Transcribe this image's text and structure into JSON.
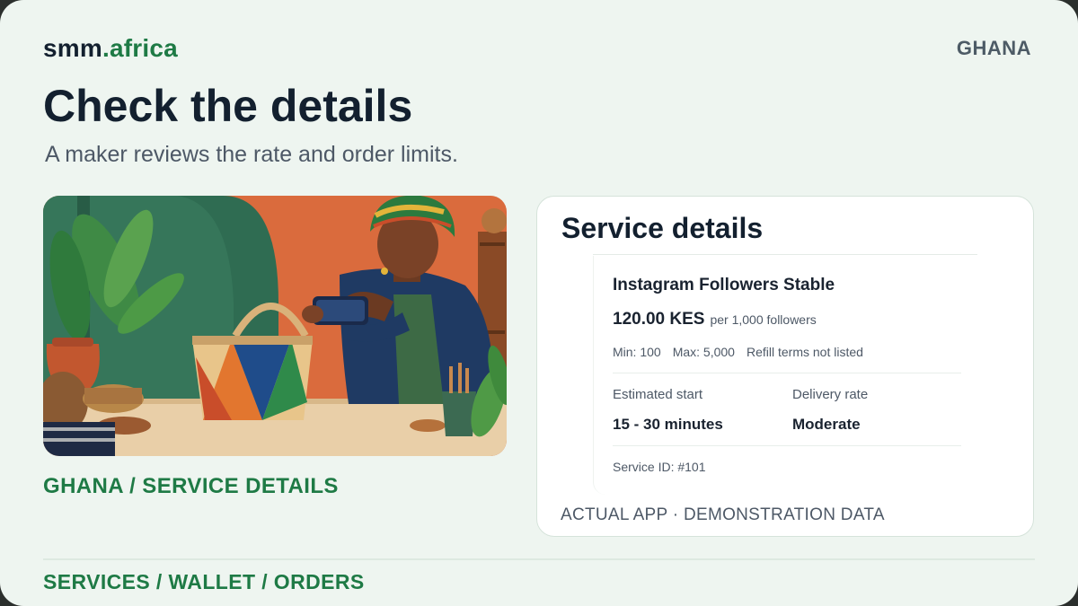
{
  "brand": {
    "name": "smm",
    "accent": ".africa"
  },
  "country": "GHANA",
  "headline": "Check the details",
  "subtitle": "A maker reviews the rate and order limits.",
  "photo_caption": "GHANA / SERVICE DETAILS",
  "card": {
    "title": "Service details",
    "service_name": "Instagram Followers Stable",
    "price": "120.00 KES",
    "price_unit": "per 1,000 followers",
    "min": "Min: 100",
    "max": "Max: 5,000",
    "refill": "Refill terms not listed",
    "estimated_start_label": "Estimated start",
    "estimated_start_value": "15 - 30 minutes",
    "delivery_rate_label": "Delivery rate",
    "delivery_rate_value": "Moderate",
    "service_id": "Service ID: #101",
    "footer": "ACTUAL APP · DEMONSTRATION DATA"
  },
  "bottom_nav": "SERVICES / WALLET / ORDERS",
  "colors": {
    "accent": "#1e7a45",
    "ink": "#13202f",
    "muted": "#4d5866",
    "background": "#eef5f0",
    "card": "#ffffff"
  }
}
